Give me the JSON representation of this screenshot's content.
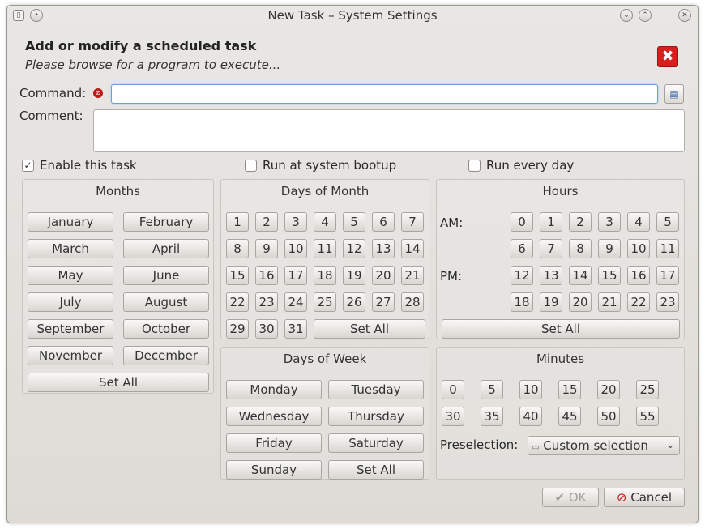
{
  "window": {
    "title": "New Task – System Settings"
  },
  "header": {
    "title": "Add or modify a scheduled task",
    "subtitle": "Please browse for a program to execute..."
  },
  "form": {
    "command_label": "Command:",
    "command_value": "",
    "comment_label": "Comment:",
    "comment_value": ""
  },
  "options": {
    "enable_label": "Enable this task",
    "enable_checked": true,
    "bootup_label": "Run at system bootup",
    "bootup_checked": false,
    "everyday_label": "Run every day",
    "everyday_checked": false
  },
  "months": {
    "title": "Months",
    "items": [
      "January",
      "February",
      "March",
      "April",
      "May",
      "June",
      "July",
      "August",
      "September",
      "October",
      "November",
      "December"
    ],
    "set_all": "Set All"
  },
  "days_of_month": {
    "title": "Days of Month",
    "items": [
      "1",
      "2",
      "3",
      "4",
      "5",
      "6",
      "7",
      "8",
      "9",
      "10",
      "11",
      "12",
      "13",
      "14",
      "15",
      "16",
      "17",
      "18",
      "19",
      "20",
      "21",
      "22",
      "23",
      "24",
      "25",
      "26",
      "27",
      "28",
      "29",
      "30",
      "31"
    ],
    "set_all": "Set All"
  },
  "hours": {
    "title": "Hours",
    "am_label": "AM:",
    "pm_label": "PM:",
    "am": [
      "0",
      "1",
      "2",
      "3",
      "4",
      "5",
      "6",
      "7",
      "8",
      "9",
      "10",
      "11"
    ],
    "pm": [
      "12",
      "13",
      "14",
      "15",
      "16",
      "17",
      "18",
      "19",
      "20",
      "21",
      "22",
      "23"
    ],
    "set_all": "Set All"
  },
  "days_of_week": {
    "title": "Days of Week",
    "items": [
      "Monday",
      "Tuesday",
      "Wednesday",
      "Thursday",
      "Friday",
      "Saturday",
      "Sunday"
    ],
    "set_all": "Set All"
  },
  "minutes": {
    "title": "Minutes",
    "items": [
      "0",
      "5",
      "10",
      "15",
      "20",
      "25",
      "30",
      "35",
      "40",
      "45",
      "50",
      "55"
    ],
    "preselection_label": "Preselection:",
    "preselection_value": "Custom selection"
  },
  "footer": {
    "ok": "OK",
    "cancel": "Cancel"
  }
}
